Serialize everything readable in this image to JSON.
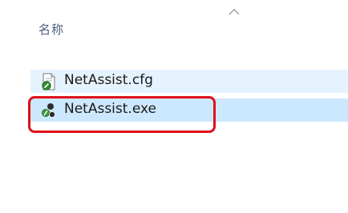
{
  "header": {
    "column_name_label": "名称",
    "sort_icon": "chevron-up-icon"
  },
  "files": [
    {
      "name": "NetAssist.cfg",
      "icon": "config-file-icon",
      "selected": false
    },
    {
      "name": "NetAssist.exe",
      "icon": "executable-app-icon",
      "selected": true
    }
  ],
  "colors": {
    "hover_row": "#e5f3ff",
    "selected_row": "#cce8ff",
    "annotation_border": "#e0101a",
    "header_text": "#4c607a"
  }
}
